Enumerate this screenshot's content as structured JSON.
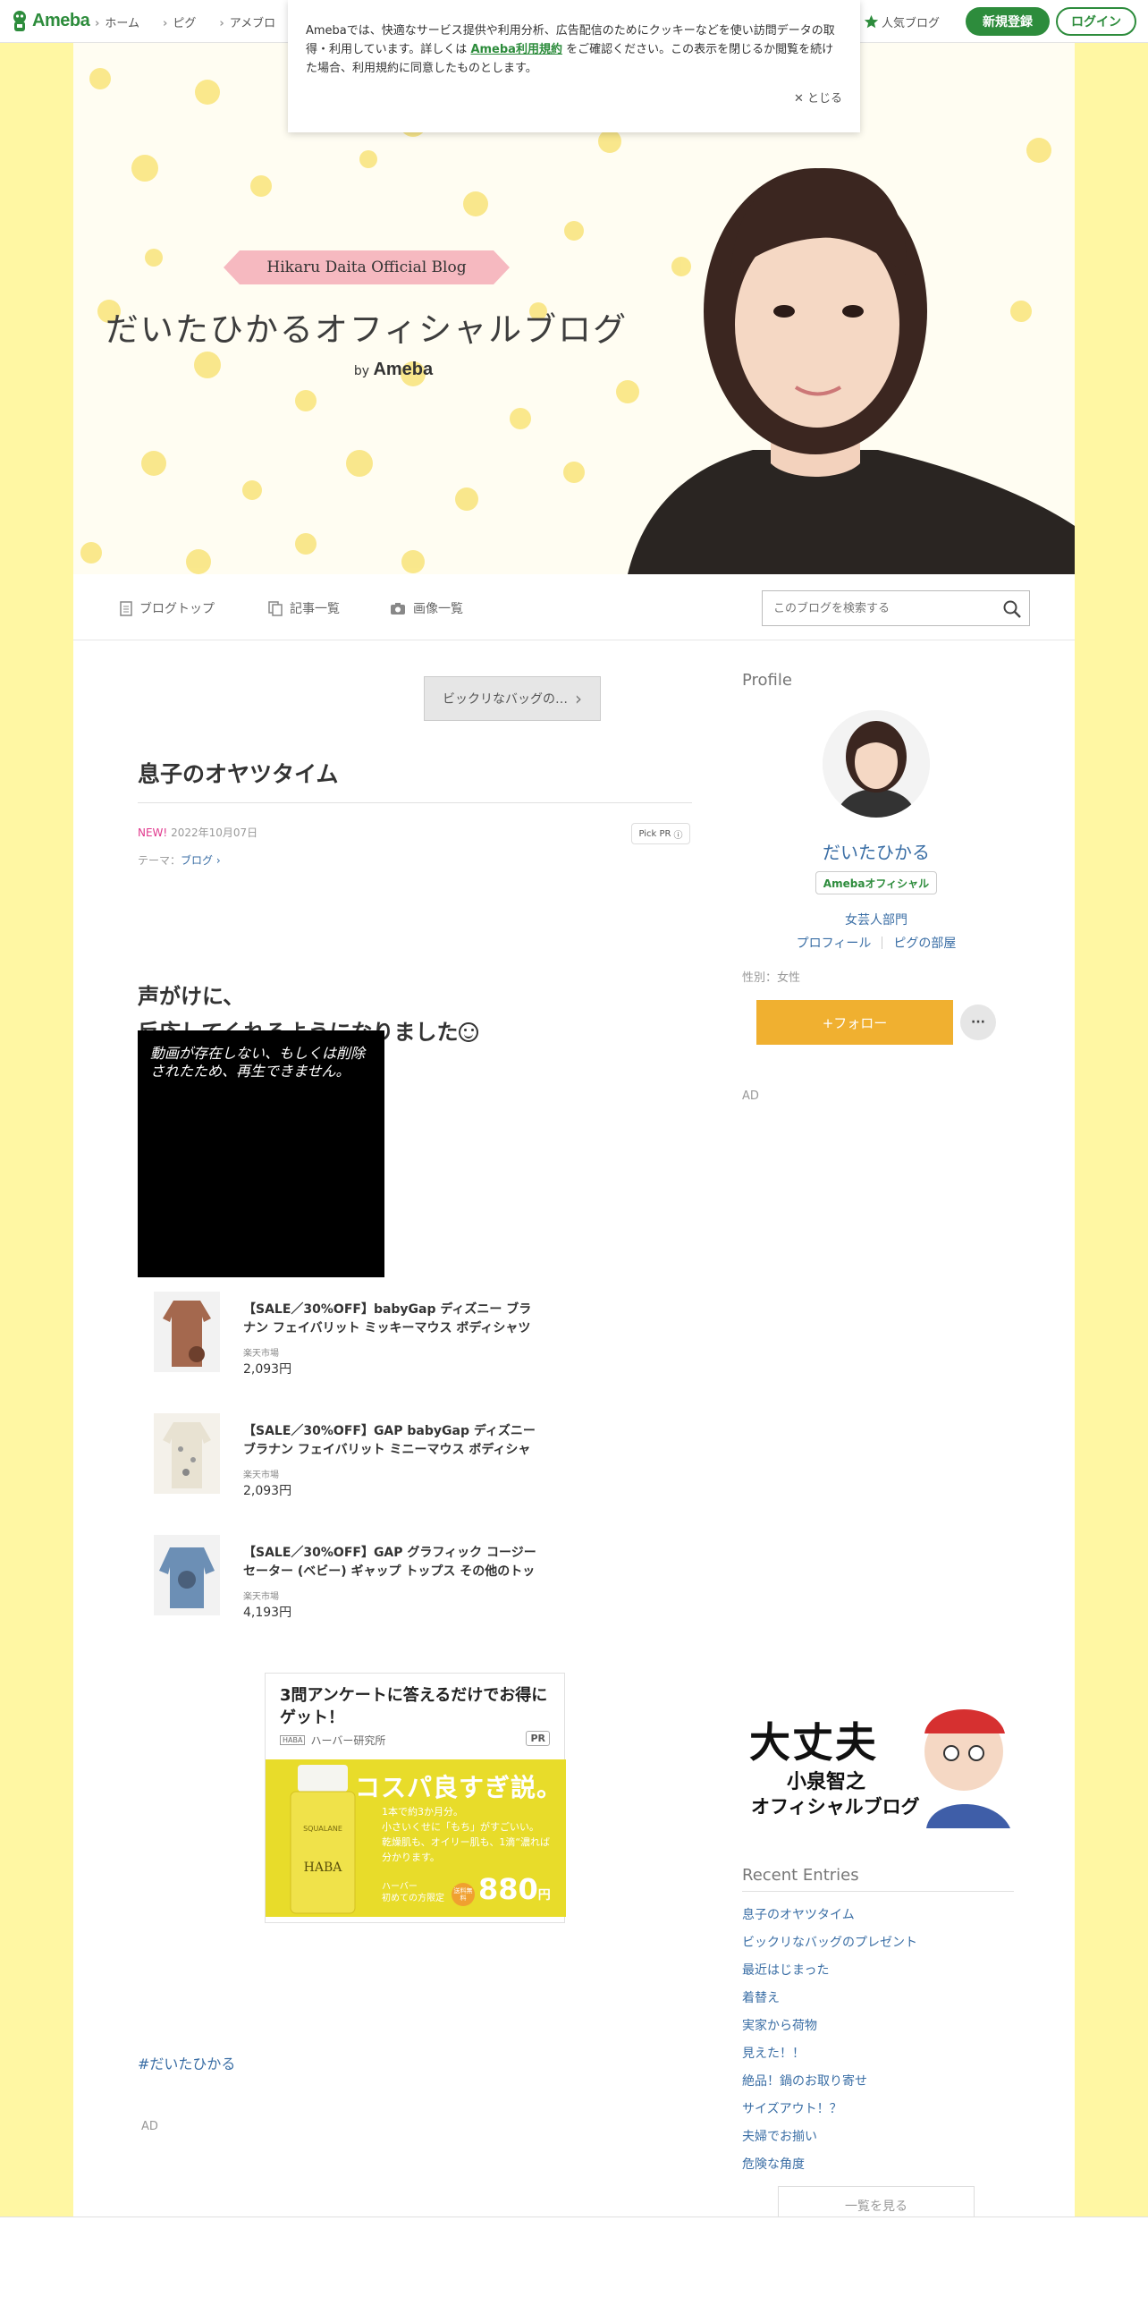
{
  "header": {
    "logo": "Ameba",
    "nav": [
      "ホーム",
      "ピグ",
      "アメブロ"
    ],
    "popular": "人気ブログ",
    "signup": "新規登録",
    "login": "ログイン"
  },
  "cookie": {
    "text_before": "Amebaでは、快適なサービス提供や利用分析、広告配信のためにクッキーなどを使い訪問データの取得・利用しています。詳しくは",
    "link": "Ameba利用規約",
    "text_after": "をご確認ください。この表示を閉じるか閲覧を続けた場合、利用規約に同意したものとします。",
    "close": "とじる"
  },
  "hero": {
    "ribbon": "Hikaru Daita Official Blog",
    "title": "だいたひかるオフィシャルブログ",
    "by": "by",
    "brand": "Ameba"
  },
  "blognav": {
    "top": "ブログトップ",
    "entries": "記事一覧",
    "images": "画像一覧",
    "search_placeholder": "このブログを検索する"
  },
  "article": {
    "prev": "ビックリなバッグの…",
    "title": "息子のオヤツタイム",
    "new": "NEW!",
    "date": "2022年10月07日",
    "pickpr": "Pick PR",
    "theme_label": "テーマ：",
    "theme": "ブログ",
    "line1": "声がけに、",
    "line2": "反応してくれるようになりました",
    "video_msg": "動画が存在しない、もしくは削除されたため、再生できません。",
    "hashtag": "#だいたひかる",
    "ad": "AD"
  },
  "products": [
    {
      "name": "【SALE／30%OFF】babyGap ディズニー ブラナン フェイバリット ミッキーマウス ボディシャツ ベビー",
      "shop": "楽天市場",
      "price": "2,093円"
    },
    {
      "name": "【SALE／30%OFF】GAP babyGap ディズニーブラナン フェイバリット ミニーマウス ボディシャツ ベビー",
      "shop": "楽天市場",
      "price": "2,093円"
    },
    {
      "name": "【SALE／30%OFF】GAP グラフィック コージーセーター (ベビー) ギャップ トップス その他のトップス",
      "shop": "楽天市場",
      "price": "4,193円"
    }
  ],
  "adcard": {
    "headline": "3問アンケートに答えるだけでお得にゲット！",
    "sponsor": "ハーバー研究所",
    "sponsor_mini": "HABA",
    "pr": "PR",
    "copy": "コスパ良すぎ説。",
    "sub1": "1本で約3か月分。",
    "sub2": "小さいくせに「もち」がすごいい。",
    "sub3": "乾燥肌も、オイリー肌も、1滴“濃れば",
    "sub4": "分かります。",
    "bottle": "HABA",
    "bottle_top": "SQUALANE",
    "price_label1": "ハーバー",
    "price_label2": "初めての方限定",
    "badge": "送料無料",
    "price": "880",
    "price_unit": "円"
  },
  "sidebar": {
    "profile_h": "Profile",
    "name": "だいたひかる",
    "official": "Amebaオフィシャル",
    "dept": "女芸人部門",
    "link_profile": "プロフィール",
    "link_room": "ピグの部屋",
    "gender": "性別：女性",
    "follow": "+フォロー",
    "more": "···",
    "ad": "AD",
    "banner_big": "大丈夫",
    "banner_name": "小泉智之",
    "banner_sub": "オフィシャルブログ",
    "recent_h": "Recent Entries",
    "recent": [
      "息子のオヤツタイム",
      "ビックリなバッグのプレゼント",
      "最近はじまった",
      "着替え",
      "実家から荷物",
      "見えた！！",
      "絶品！鍋のお取り寄せ",
      "サイズアウト！？",
      "夫婦でお揃い",
      "危険な角度"
    ],
    "see_all": "一覧を見る"
  },
  "colors": {
    "ameba_green": "#2d8c3c",
    "page_bg": "#fff7a3",
    "link": "#3a6ea5",
    "follow": "#f0b030",
    "new": "#e0388d"
  }
}
